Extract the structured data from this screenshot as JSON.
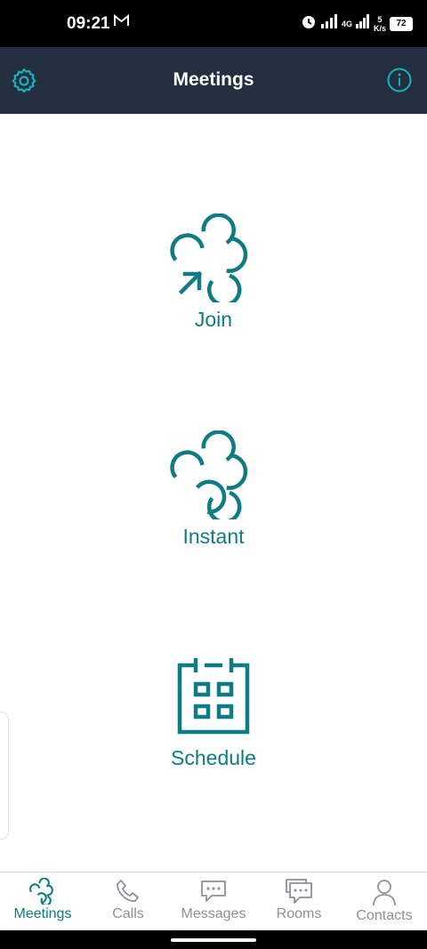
{
  "status_bar": {
    "time": "09:21",
    "network": "4G",
    "speed_value": "5",
    "speed_unit": "K/s",
    "battery": "72"
  },
  "header": {
    "title": "Meetings"
  },
  "actions": [
    {
      "label": "Join",
      "icon": "join-icon"
    },
    {
      "label": "Instant",
      "icon": "instant-meeting-icon"
    },
    {
      "label": "Schedule",
      "icon": "calendar-icon"
    }
  ],
  "bottom_nav": [
    {
      "label": "Meetings",
      "icon": "meetings-icon",
      "active": true
    },
    {
      "label": "Calls",
      "icon": "phone-icon",
      "active": false
    },
    {
      "label": "Messages",
      "icon": "chat-bubble-icon",
      "active": false
    },
    {
      "label": "Rooms",
      "icon": "rooms-icon",
      "active": false
    },
    {
      "label": "Contacts",
      "icon": "person-icon",
      "active": false
    }
  ],
  "colors": {
    "header_bg": "#232f3e",
    "accent": "#0f7b82",
    "header_icon": "#1ab0bd",
    "inactive": "#8d9096"
  }
}
